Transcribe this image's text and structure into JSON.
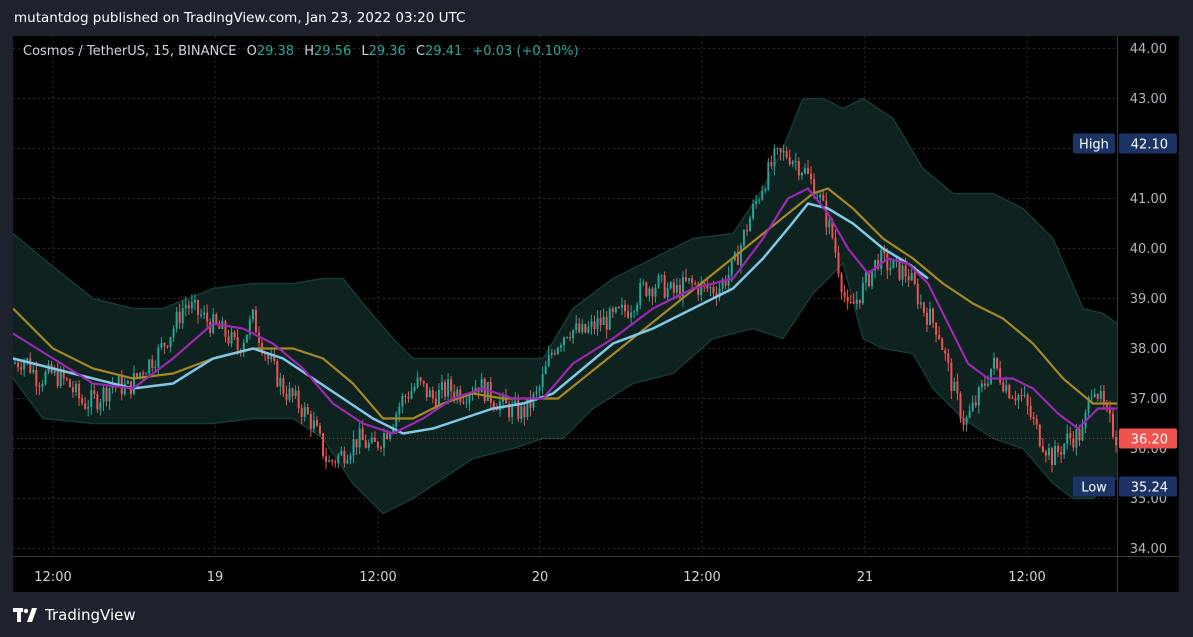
{
  "header": {
    "published_text": "mutantdog published on TradingView.com, Jan 23, 2022 03:20 UTC"
  },
  "legend": {
    "symbol": "Cosmos / TetherUS, 15, BINANCE",
    "open_label": "O",
    "open_value": "29.38",
    "high_label": "H",
    "high_value": "29.56",
    "low_label": "L",
    "low_value": "29.36",
    "close_label": "C",
    "close_value": "29.41",
    "change": "+0.03 (+0.10%)"
  },
  "footer": {
    "brand": "TradingView"
  },
  "colors": {
    "up": "#26a69a",
    "down": "#ef5350",
    "ma_fast": "#9c27b0",
    "ma_mid": "#82c8e8",
    "ma_slow": "#a48824",
    "band_fill": "#0e2220",
    "band_line": "#153a38",
    "label_bg": "#1c3366",
    "price_bg": "#ef5350"
  },
  "chart_data": {
    "type": "candlestick",
    "y_axis": {
      "ylim": [
        33.85,
        44.25
      ],
      "ticks": [
        "44.00",
        "43.00",
        "42.00",
        "41.00",
        "40.00",
        "39.00",
        "38.00",
        "37.00",
        "36.00",
        "35.00",
        "34.00"
      ]
    },
    "x_axis": {
      "ticks": [
        "12:00",
        "19",
        "12:00",
        "20",
        "12:00",
        "21",
        "12:00"
      ]
    },
    "price_labels": [
      {
        "name": "High",
        "value": "42.10"
      },
      {
        "name": "Low",
        "value": "35.24"
      },
      {
        "name": "",
        "value": "36.20"
      }
    ],
    "close_path": [
      [
        0,
        37.7
      ],
      [
        12,
        37.8
      ],
      [
        25,
        37.4
      ],
      [
        40,
        37.5
      ],
      [
        55,
        37.3
      ],
      [
        70,
        36.9
      ],
      [
        85,
        37.0
      ],
      [
        100,
        37.3
      ],
      [
        115,
        37.2
      ],
      [
        130,
        37.6
      ],
      [
        145,
        37.9
      ],
      [
        160,
        38.4
      ],
      [
        172,
        38.9
      ],
      [
        185,
        38.7
      ],
      [
        198,
        38.5
      ],
      [
        212,
        38.3
      ],
      [
        225,
        38.0
      ],
      [
        240,
        38.6
      ],
      [
        255,
        37.8
      ],
      [
        270,
        37.2
      ],
      [
        285,
        36.9
      ],
      [
        300,
        36.5
      ],
      [
        315,
        35.7
      ],
      [
        330,
        35.9
      ],
      [
        345,
        36.2
      ],
      [
        360,
        36.0
      ],
      [
        375,
        36.4
      ],
      [
        390,
        37.0
      ],
      [
        405,
        37.3
      ],
      [
        420,
        37.0
      ],
      [
        435,
        37.2
      ],
      [
        450,
        37.1
      ],
      [
        465,
        37.3
      ],
      [
        480,
        37.0
      ],
      [
        495,
        36.8
      ],
      [
        510,
        36.7
      ],
      [
        525,
        37.1
      ],
      [
        540,
        38.0
      ],
      [
        555,
        38.4
      ],
      [
        570,
        38.3
      ],
      [
        585,
        38.5
      ],
      [
        600,
        38.6
      ],
      [
        615,
        38.8
      ],
      [
        630,
        39.2
      ],
      [
        645,
        39.3
      ],
      [
        660,
        39.1
      ],
      [
        675,
        39.3
      ],
      [
        690,
        39.2
      ],
      [
        705,
        39.2
      ],
      [
        720,
        39.6
      ],
      [
        735,
        40.5
      ],
      [
        750,
        41.3
      ],
      [
        762,
        41.8
      ],
      [
        775,
        41.9
      ],
      [
        790,
        41.6
      ],
      [
        805,
        41.1
      ],
      [
        820,
        40.2
      ],
      [
        835,
        38.7
      ],
      [
        850,
        39.2
      ],
      [
        865,
        39.8
      ],
      [
        880,
        39.6
      ],
      [
        895,
        39.5
      ],
      [
        910,
        38.8
      ],
      [
        925,
        38.4
      ],
      [
        940,
        37.2
      ],
      [
        952,
        36.5
      ],
      [
        965,
        37.0
      ],
      [
        980,
        37.7
      ],
      [
        995,
        37.2
      ],
      [
        1010,
        37.0
      ],
      [
        1025,
        36.3
      ],
      [
        1040,
        35.8
      ],
      [
        1055,
        36.2
      ],
      [
        1070,
        36.3
      ],
      [
        1080,
        37.4
      ],
      [
        1090,
        36.8
      ],
      [
        1104,
        36.2
      ]
    ],
    "ma_fast": [
      [
        0,
        38.3
      ],
      [
        40,
        37.8
      ],
      [
        80,
        37.3
      ],
      [
        120,
        37.2
      ],
      [
        160,
        37.8
      ],
      [
        200,
        38.5
      ],
      [
        230,
        38.4
      ],
      [
        260,
        38.1
      ],
      [
        290,
        37.6
      ],
      [
        320,
        36.9
      ],
      [
        350,
        36.5
      ],
      [
        380,
        36.3
      ],
      [
        410,
        36.6
      ],
      [
        440,
        37.0
      ],
      [
        470,
        37.2
      ],
      [
        500,
        37.0
      ],
      [
        530,
        37.0
      ],
      [
        560,
        37.7
      ],
      [
        600,
        38.2
      ],
      [
        640,
        38.8
      ],
      [
        680,
        39.2
      ],
      [
        720,
        39.4
      ],
      [
        750,
        40.2
      ],
      [
        775,
        41.0
      ],
      [
        795,
        41.2
      ],
      [
        815,
        40.7
      ],
      [
        835,
        40.0
      ],
      [
        855,
        39.5
      ],
      [
        875,
        39.8
      ],
      [
        895,
        39.7
      ],
      [
        915,
        39.3
      ],
      [
        935,
        38.5
      ],
      [
        955,
        37.7
      ],
      [
        975,
        37.4
      ],
      [
        1000,
        37.4
      ],
      [
        1020,
        37.2
      ],
      [
        1045,
        36.7
      ],
      [
        1065,
        36.4
      ],
      [
        1085,
        36.8
      ],
      [
        1104,
        36.8
      ]
    ],
    "ma_mid": [
      [
        0,
        37.8
      ],
      [
        60,
        37.5
      ],
      [
        120,
        37.2
      ],
      [
        160,
        37.3
      ],
      [
        200,
        37.8
      ],
      [
        240,
        38.0
      ],
      [
        270,
        37.8
      ],
      [
        300,
        37.4
      ],
      [
        330,
        37.0
      ],
      [
        360,
        36.6
      ],
      [
        390,
        36.3
      ],
      [
        420,
        36.4
      ],
      [
        450,
        36.6
      ],
      [
        480,
        36.8
      ],
      [
        510,
        36.9
      ],
      [
        540,
        37.1
      ],
      [
        570,
        37.6
      ],
      [
        600,
        38.1
      ],
      [
        640,
        38.4
      ],
      [
        680,
        38.8
      ],
      [
        720,
        39.2
      ],
      [
        750,
        39.8
      ],
      [
        775,
        40.4
      ],
      [
        795,
        40.9
      ],
      [
        815,
        40.8
      ],
      [
        840,
        40.5
      ],
      [
        870,
        40.0
      ],
      [
        895,
        39.7
      ],
      [
        915,
        39.4
      ]
    ],
    "ma_slow": [
      [
        0,
        38.8
      ],
      [
        40,
        38.0
      ],
      [
        80,
        37.6
      ],
      [
        120,
        37.4
      ],
      [
        160,
        37.5
      ],
      [
        200,
        37.8
      ],
      [
        240,
        38.0
      ],
      [
        280,
        38.0
      ],
      [
        310,
        37.8
      ],
      [
        340,
        37.3
      ],
      [
        370,
        36.6
      ],
      [
        400,
        36.6
      ],
      [
        430,
        36.9
      ],
      [
        460,
        37.1
      ],
      [
        490,
        37.0
      ],
      [
        520,
        37.0
      ],
      [
        545,
        37.0
      ],
      [
        800,
        41.1
      ],
      [
        815,
        41.2
      ],
      [
        840,
        40.8
      ],
      [
        870,
        40.2
      ],
      [
        900,
        39.8
      ],
      [
        930,
        39.3
      ],
      [
        960,
        38.9
      ],
      [
        990,
        38.6
      ],
      [
        1020,
        38.1
      ],
      [
        1050,
        37.4
      ],
      [
        1080,
        36.9
      ],
      [
        1104,
        36.9
      ]
    ],
    "band_upper": [
      [
        0,
        40.3
      ],
      [
        30,
        39.8
      ],
      [
        80,
        39.0
      ],
      [
        120,
        38.8
      ],
      [
        150,
        38.8
      ],
      [
        200,
        39.2
      ],
      [
        240,
        39.3
      ],
      [
        280,
        39.3
      ],
      [
        310,
        39.4
      ],
      [
        330,
        39.4
      ],
      [
        350,
        38.9
      ],
      [
        380,
        38.2
      ],
      [
        400,
        37.8
      ],
      [
        430,
        37.8
      ],
      [
        470,
        37.8
      ],
      [
        500,
        37.8
      ],
      [
        530,
        37.8
      ],
      [
        560,
        38.8
      ],
      [
        600,
        39.4
      ],
      [
        640,
        39.8
      ],
      [
        680,
        40.2
      ],
      [
        720,
        40.3
      ],
      [
        750,
        41.2
      ],
      [
        770,
        42.0
      ],
      [
        790,
        43.0
      ],
      [
        810,
        43.0
      ],
      [
        830,
        42.8
      ],
      [
        850,
        43.0
      ],
      [
        880,
        42.6
      ],
      [
        910,
        41.6
      ],
      [
        940,
        41.1
      ],
      [
        980,
        41.1
      ],
      [
        1010,
        40.8
      ],
      [
        1040,
        40.2
      ],
      [
        1070,
        38.8
      ],
      [
        1090,
        38.7
      ],
      [
        1104,
        38.5
      ]
    ],
    "band_lower": [
      [
        0,
        37.4
      ],
      [
        30,
        36.6
      ],
      [
        80,
        36.5
      ],
      [
        120,
        36.5
      ],
      [
        160,
        36.5
      ],
      [
        200,
        36.5
      ],
      [
        240,
        36.6
      ],
      [
        280,
        36.6
      ],
      [
        310,
        36.2
      ],
      [
        340,
        35.3
      ],
      [
        370,
        34.7
      ],
      [
        400,
        35.0
      ],
      [
        430,
        35.4
      ],
      [
        460,
        35.8
      ],
      [
        500,
        36.0
      ],
      [
        530,
        36.2
      ],
      [
        550,
        36.2
      ],
      [
        580,
        36.8
      ],
      [
        620,
        37.3
      ],
      [
        660,
        37.5
      ],
      [
        700,
        38.2
      ],
      [
        740,
        38.4
      ],
      [
        770,
        38.2
      ],
      [
        800,
        39.1
      ],
      [
        830,
        39.7
      ],
      [
        850,
        38.2
      ],
      [
        870,
        38.0
      ],
      [
        900,
        37.9
      ],
      [
        920,
        37.2
      ],
      [
        950,
        36.6
      ],
      [
        980,
        36.2
      ],
      [
        1010,
        36.0
      ],
      [
        1040,
        35.3
      ],
      [
        1060,
        35.0
      ],
      [
        1080,
        35.0
      ],
      [
        1104,
        35.4
      ]
    ]
  }
}
